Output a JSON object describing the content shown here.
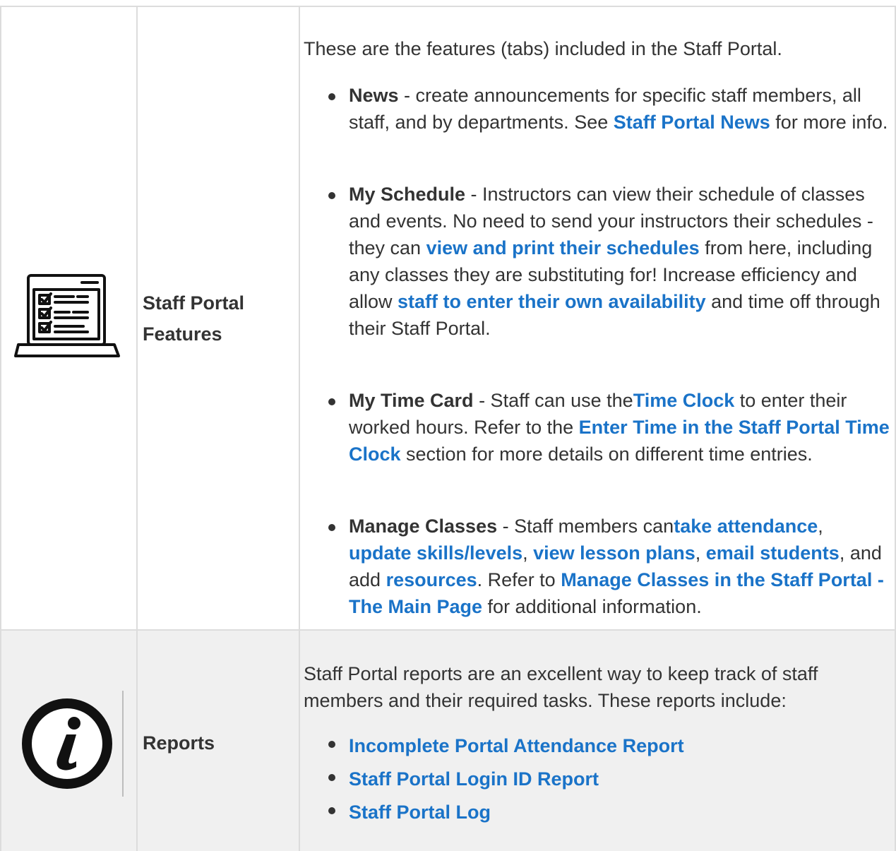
{
  "rows": [
    {
      "icon": "checklist-laptop-icon",
      "label_line1": "Staff Portal",
      "label_line2": "Features",
      "intro": "These are the features (tabs) included in the Staff Portal.",
      "items": [
        {
          "title": "News",
          "t1": " - create announcements for specific staff members, all staff, and by departments. See ",
          "l1": "Staff Portal News",
          "t2": " for more info."
        },
        {
          "title": "My Schedule",
          "t1": " - Instructors can view their schedule of classes and events. No need to send your instructors their schedules - they can ",
          "l1": "view and print their schedules",
          "t2": " from here, including any classes they are substituting for! Increase efficiency and allow ",
          "l2": "staff to enter their own availability",
          "t3": " and time off through their Staff Portal."
        },
        {
          "title": "My Time Card",
          "t1": " - Staff can use the",
          "l1": "Time Clock",
          "t2": " to enter their worked hours. Refer to the ",
          "l2": "Enter Time in the Staff Portal Time Clock",
          "t3": " section for more details on different time entries."
        },
        {
          "title": "Manage Classes",
          "t1": " - Staff members can",
          "l1": "take attendance",
          "t2": ", ",
          "l2": "update skills/levels",
          "t3": ", ",
          "l3": "view lesson plans",
          "t4": ", ",
          "l4": "email students",
          "t5": ", and add ",
          "l5": "resources",
          "t6": ". Refer to ",
          "l6": "Manage Classes in the Staff Portal - The Main Page",
          "t7": " for additional information."
        }
      ]
    },
    {
      "icon": "info-icon",
      "label": "Reports",
      "intro": "Staff Portal reports are an excellent way to keep track of staff members and their required tasks. These reports include:",
      "links": [
        "Incomplete Portal Attendance Report",
        "Staff Portal Login ID Report",
        "Staff Portal Log"
      ]
    }
  ],
  "colors": {
    "link": "#1a73c8",
    "text": "#333333",
    "border": "#dcdcdc",
    "shaded_row": "#f0f0f0"
  }
}
